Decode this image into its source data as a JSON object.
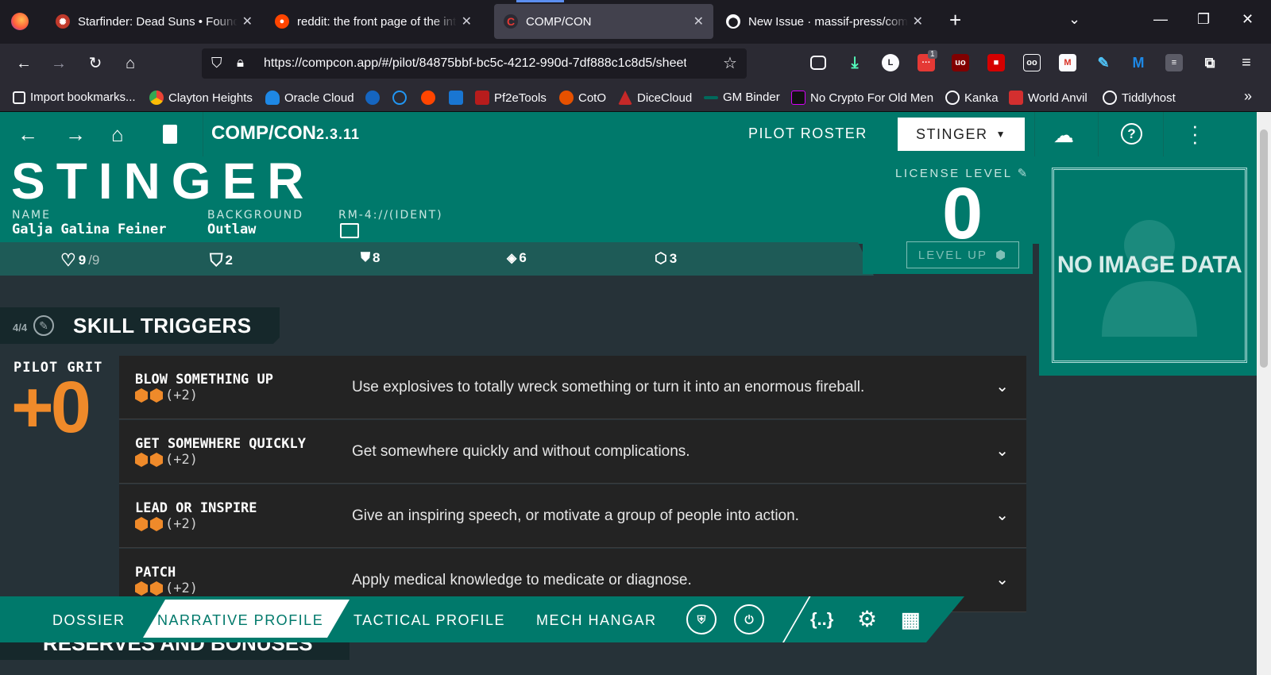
{
  "browser": {
    "tabs": [
      {
        "title": "Starfinder: Dead Suns • Foundry VTT",
        "active": false
      },
      {
        "title": "reddit: the front page of the internet",
        "active": false
      },
      {
        "title": "COMP/CON",
        "active": true
      },
      {
        "title": "New Issue · massif-press/compcon",
        "active": false
      }
    ],
    "new_tab_label": "+",
    "url": "https://compcon.app/#/pilot/84875bbf-bc5c-4212-990d-7df888c1c8d5/sheet",
    "download_badge": "1",
    "bookmarks": [
      {
        "label": "Import bookmarks...",
        "color": "#fbfbfe"
      },
      {
        "label": "Clayton Heights",
        "color": "#f4b400"
      },
      {
        "label": "Oracle Cloud",
        "color": "#1e88e5"
      },
      {
        "label": "",
        "color": "#1565c0"
      },
      {
        "label": "",
        "color": "#2196f3"
      },
      {
        "label": "",
        "color": "#ff4500"
      },
      {
        "label": "",
        "color": "#1976d2"
      },
      {
        "label": "Pf2eTools",
        "color": "#b71c1c"
      },
      {
        "label": "CotO",
        "color": "#e65100"
      },
      {
        "label": "DiceCloud",
        "color": "#c62828"
      },
      {
        "label": "GM Binder",
        "color": "#00695c"
      },
      {
        "label": "No Crypto For Old Men",
        "color": "#111111"
      },
      {
        "label": "Kanka",
        "color": "#fbfbfe"
      },
      {
        "label": "World Anvil",
        "color": "#d32f2f"
      },
      {
        "label": "Tiddlyhost",
        "color": "#fbfbfe"
      }
    ]
  },
  "app": {
    "brand": "COMP/CON",
    "version": "2.3.11",
    "roster_label": "PILOT ROSTER",
    "pilot_selector": "STINGER",
    "header": {
      "callsign": "STINGER",
      "name_label": "NAME",
      "name": "Galja Galina Feiner",
      "background_label": "BACKGROUND",
      "background": "Outlaw",
      "ident_label": "RM-4://(IDENT)",
      "license_label": "LICENSE LEVEL",
      "license_level": "0",
      "level_up": "LEVEL UP",
      "no_image": "NO IMAGE DATA"
    },
    "stats": {
      "hp": "9",
      "hp_max": "/9",
      "armor": "2",
      "edef": "8",
      "evasion": "6",
      "speed": "3"
    },
    "section": {
      "ratio": "4/4",
      "title": "SKILL TRIGGERS",
      "grit_label": "PILOT GRIT",
      "grit_value": "+0"
    },
    "skills": [
      {
        "name": "BLOW SOMETHING UP",
        "rank": "(+2)",
        "desc": "Use explosives to totally wreck something or turn it into an enormous fireball."
      },
      {
        "name": "GET SOMEWHERE QUICKLY",
        "rank": "(+2)",
        "desc": "Get somewhere quickly and without complications."
      },
      {
        "name": "LEAD OR INSPIRE",
        "rank": "(+2)",
        "desc": "Give an inspiring speech, or motivate a group of people into action."
      },
      {
        "name": "PATCH",
        "rank": "(+2)",
        "desc": "Apply medical knowledge to medicate or diagnose."
      }
    ],
    "bottom_nav": {
      "dossier": "DOSSIER",
      "narrative": "NARRATIVE PROFILE",
      "tactical": "TACTICAL PROFILE",
      "hangar": "MECH HANGAR",
      "json": "{..}"
    },
    "next_section": "RESERVES AND BONUSES"
  },
  "colors": {
    "teal": "#00796b",
    "dark_teal": "#1e5b57",
    "bg": "#263238",
    "accent_orange": "#ef8a2a"
  }
}
